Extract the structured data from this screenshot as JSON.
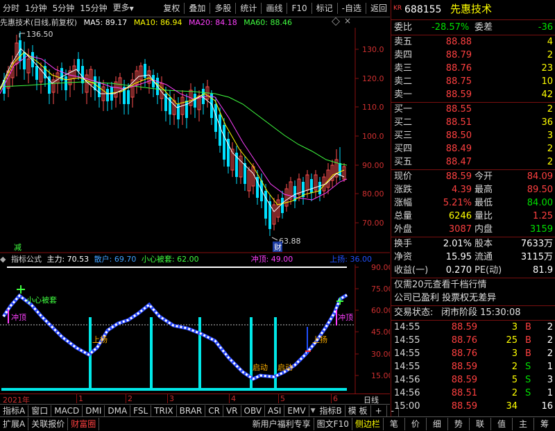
{
  "toolbar": {
    "left": [
      "分时",
      "1分钟",
      "5分钟",
      "15分钟",
      "更多"
    ],
    "right": [
      "复权",
      "叠加",
      "多股",
      "统计",
      "画线",
      "F10",
      "标记",
      "-自选",
      "返回"
    ]
  },
  "main": {
    "title": "先惠技术(日线,前复权)",
    "ma": [
      {
        "label": "MA5: 89.17",
        "color": "#ffffff"
      },
      {
        "label": "MA10: 86.94",
        "color": "#ffff00"
      },
      {
        "label": "MA20: 84.18",
        "color": "#ff40ff"
      },
      {
        "label": "MA60: 88.46",
        "color": "#40ff40"
      }
    ],
    "high_label": "136.50",
    "low_label": "63.88",
    "jian": "减",
    "cai": "财",
    "axis": [
      "130.0",
      "120.0",
      "110.0",
      "100.0",
      "90.00",
      "80.00",
      "70.00"
    ]
  },
  "indicator": {
    "title": "指标公式",
    "zhuli": "主力: 70.53",
    "sanhu": "散户: 69.70",
    "xiaoxin": "小心被套: 62.00",
    "chongding": "冲顶: 49.00",
    "shangyang": "上扬: 36.00",
    "axis": [
      "90.00",
      "75.00",
      "60.00",
      "45.00",
      "30.00",
      "15.00"
    ],
    "annotations": {
      "xiaoxin_short": "小心被套",
      "chong": "冲顶",
      "yang": "上扬",
      "qidong": "启动"
    }
  },
  "xaxis": {
    "year": "2021年",
    "months": [
      "1",
      "2",
      "3",
      "4",
      "5",
      "6"
    ],
    "period": "日线"
  },
  "tabs": [
    "指标A",
    "窗口",
    "MACD",
    "DMI",
    "DMA",
    "FSL",
    "TRIX",
    "BRAR",
    "CR",
    "VR",
    "OBV",
    "ASI",
    "EMV",
    "指标B",
    "模 板",
    "+",
    "-"
  ],
  "status": {
    "left": [
      "扩展A",
      "关联报价",
      "财富圈"
    ],
    "mid": [
      "新用户福利专享",
      "图文F10",
      "侧边栏"
    ],
    "right": [
      "笔",
      "价",
      "细",
      "势",
      "联",
      "值",
      "主",
      "筹"
    ]
  },
  "quote": {
    "code": "688155",
    "name": "先惠技术",
    "badge": "KR",
    "weibi_label": "委比",
    "weibi": "-28.57%",
    "weicha_label": "委差",
    "weicha": "-36",
    "sell": [
      {
        "label": "卖五",
        "price": "88.88",
        "vol": "4"
      },
      {
        "label": "卖四",
        "price": "88.79",
        "vol": "2"
      },
      {
        "label": "卖三",
        "price": "88.76",
        "vol": "23"
      },
      {
        "label": "卖二",
        "price": "88.75",
        "vol": "10"
      },
      {
        "label": "卖一",
        "price": "88.59",
        "vol": "42"
      }
    ],
    "buy": [
      {
        "label": "买一",
        "price": "88.55",
        "vol": "2"
      },
      {
        "label": "买二",
        "price": "88.51",
        "vol": "36"
      },
      {
        "label": "买三",
        "price": "88.50",
        "vol": "3"
      },
      {
        "label": "买四",
        "price": "88.49",
        "vol": "2"
      },
      {
        "label": "买五",
        "price": "88.47",
        "vol": "2"
      }
    ],
    "stats": [
      {
        "l1": "现价",
        "v1": "88.59",
        "c1": "#ff4040",
        "l2": "今开",
        "v2": "84.09",
        "c2": "#ff4040"
      },
      {
        "l1": "涨跌",
        "v1": "4.39",
        "c1": "#ff4040",
        "l2": "最高",
        "v2": "89.50",
        "c2": "#ff4040"
      },
      {
        "l1": "涨幅",
        "v1": "5.21%",
        "c1": "#ff4040",
        "l2": "最低",
        "v2": "84.00",
        "c2": "#00e000"
      },
      {
        "l1": "总量",
        "v1": "6246",
        "c1": "#ffff00",
        "l2": "量比",
        "v2": "1.25",
        "c2": "#ff4040"
      },
      {
        "l1": "外盘",
        "v1": "3087",
        "c1": "#ff4040",
        "l2": "内盘",
        "v2": "3159",
        "c2": "#00e000"
      }
    ],
    "fin": [
      {
        "l1": "换手",
        "v1": "2.01%",
        "l2": "股本",
        "v2": "7633万"
      },
      {
        "l1": "净资",
        "v1": "15.95",
        "l2": "流通",
        "v2": "3115万"
      },
      {
        "l1": "收益(一)",
        "v1": "0.270",
        "l2": "PE(动)",
        "v2": "81.9"
      }
    ],
    "promo1": "仅需20元查看千档行情",
    "promo2": "公司已盈利 投票权无差异",
    "trade_state_label": "交易状态:",
    "trade_state": "闭市阶段 15:30:08",
    "ticks": [
      {
        "t": "14:55",
        "p": "88.59",
        "v": "3",
        "d": "B",
        "n": "2"
      },
      {
        "t": "14:55",
        "p": "88.76",
        "v": "25",
        "d": "B",
        "n": "2"
      },
      {
        "t": "14:55",
        "p": "88.76",
        "v": "3",
        "d": "B",
        "n": "2"
      },
      {
        "t": "14:55",
        "p": "88.59",
        "v": "2",
        "d": "S",
        "n": "1"
      },
      {
        "t": "14:56",
        "p": "88.59",
        "v": "5",
        "d": "S",
        "n": "3"
      },
      {
        "t": "14:56",
        "p": "88.51",
        "v": "2",
        "d": "S",
        "n": "1"
      },
      {
        "t": "15:00",
        "p": "88.59",
        "v": "34",
        "d": "",
        "n": "16"
      }
    ]
  }
}
